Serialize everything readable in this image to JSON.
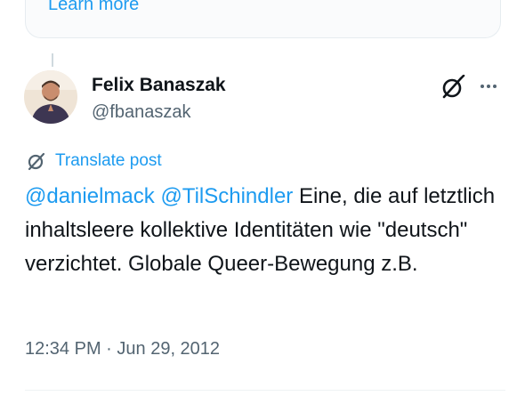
{
  "card": {
    "learn_more": "Learn more"
  },
  "author": {
    "display_name": "Felix Banaszak",
    "handle": "@fbanaszak"
  },
  "translate": {
    "label": "Translate post"
  },
  "tweet": {
    "mention1": "@danielmack",
    "mention2": "@TilSchindler",
    "text": " Eine, die auf letztlich inhaltsleere kollektive Identitäten wie \"deutsch\" verzichtet. Globale Queer-Bewegung z.B."
  },
  "meta": {
    "time": "12:34 PM",
    "separator": " · ",
    "date": "Jun 29, 2012"
  },
  "colors": {
    "accent": "#1d9bf0",
    "text": "#0f1419",
    "secondary": "#536471"
  },
  "icons": [
    "grok-icon",
    "more-icon",
    "translate-icon"
  ]
}
